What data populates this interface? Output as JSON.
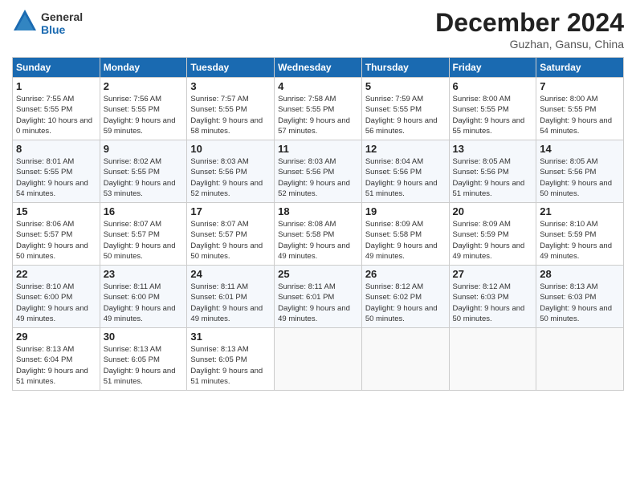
{
  "header": {
    "logo_line1": "General",
    "logo_line2": "Blue",
    "month": "December 2024",
    "location": "Guzhan, Gansu, China"
  },
  "days_of_week": [
    "Sunday",
    "Monday",
    "Tuesday",
    "Wednesday",
    "Thursday",
    "Friday",
    "Saturday"
  ],
  "weeks": [
    [
      {
        "day": 1,
        "sunrise": "7:55 AM",
        "sunset": "5:55 PM",
        "daylight": "10 hours and 0 minutes."
      },
      {
        "day": 2,
        "sunrise": "7:56 AM",
        "sunset": "5:55 PM",
        "daylight": "9 hours and 59 minutes."
      },
      {
        "day": 3,
        "sunrise": "7:57 AM",
        "sunset": "5:55 PM",
        "daylight": "9 hours and 58 minutes."
      },
      {
        "day": 4,
        "sunrise": "7:58 AM",
        "sunset": "5:55 PM",
        "daylight": "9 hours and 57 minutes."
      },
      {
        "day": 5,
        "sunrise": "7:59 AM",
        "sunset": "5:55 PM",
        "daylight": "9 hours and 56 minutes."
      },
      {
        "day": 6,
        "sunrise": "8:00 AM",
        "sunset": "5:55 PM",
        "daylight": "9 hours and 55 minutes."
      },
      {
        "day": 7,
        "sunrise": "8:00 AM",
        "sunset": "5:55 PM",
        "daylight": "9 hours and 54 minutes."
      }
    ],
    [
      {
        "day": 8,
        "sunrise": "8:01 AM",
        "sunset": "5:55 PM",
        "daylight": "9 hours and 54 minutes."
      },
      {
        "day": 9,
        "sunrise": "8:02 AM",
        "sunset": "5:55 PM",
        "daylight": "9 hours and 53 minutes."
      },
      {
        "day": 10,
        "sunrise": "8:03 AM",
        "sunset": "5:56 PM",
        "daylight": "9 hours and 52 minutes."
      },
      {
        "day": 11,
        "sunrise": "8:03 AM",
        "sunset": "5:56 PM",
        "daylight": "9 hours and 52 minutes."
      },
      {
        "day": 12,
        "sunrise": "8:04 AM",
        "sunset": "5:56 PM",
        "daylight": "9 hours and 51 minutes."
      },
      {
        "day": 13,
        "sunrise": "8:05 AM",
        "sunset": "5:56 PM",
        "daylight": "9 hours and 51 minutes."
      },
      {
        "day": 14,
        "sunrise": "8:05 AM",
        "sunset": "5:56 PM",
        "daylight": "9 hours and 50 minutes."
      }
    ],
    [
      {
        "day": 15,
        "sunrise": "8:06 AM",
        "sunset": "5:57 PM",
        "daylight": "9 hours and 50 minutes."
      },
      {
        "day": 16,
        "sunrise": "8:07 AM",
        "sunset": "5:57 PM",
        "daylight": "9 hours and 50 minutes."
      },
      {
        "day": 17,
        "sunrise": "8:07 AM",
        "sunset": "5:57 PM",
        "daylight": "9 hours and 50 minutes."
      },
      {
        "day": 18,
        "sunrise": "8:08 AM",
        "sunset": "5:58 PM",
        "daylight": "9 hours and 49 minutes."
      },
      {
        "day": 19,
        "sunrise": "8:09 AM",
        "sunset": "5:58 PM",
        "daylight": "9 hours and 49 minutes."
      },
      {
        "day": 20,
        "sunrise": "8:09 AM",
        "sunset": "5:59 PM",
        "daylight": "9 hours and 49 minutes."
      },
      {
        "day": 21,
        "sunrise": "8:10 AM",
        "sunset": "5:59 PM",
        "daylight": "9 hours and 49 minutes."
      }
    ],
    [
      {
        "day": 22,
        "sunrise": "8:10 AM",
        "sunset": "6:00 PM",
        "daylight": "9 hours and 49 minutes."
      },
      {
        "day": 23,
        "sunrise": "8:11 AM",
        "sunset": "6:00 PM",
        "daylight": "9 hours and 49 minutes."
      },
      {
        "day": 24,
        "sunrise": "8:11 AM",
        "sunset": "6:01 PM",
        "daylight": "9 hours and 49 minutes."
      },
      {
        "day": 25,
        "sunrise": "8:11 AM",
        "sunset": "6:01 PM",
        "daylight": "9 hours and 49 minutes."
      },
      {
        "day": 26,
        "sunrise": "8:12 AM",
        "sunset": "6:02 PM",
        "daylight": "9 hours and 50 minutes."
      },
      {
        "day": 27,
        "sunrise": "8:12 AM",
        "sunset": "6:03 PM",
        "daylight": "9 hours and 50 minutes."
      },
      {
        "day": 28,
        "sunrise": "8:13 AM",
        "sunset": "6:03 PM",
        "daylight": "9 hours and 50 minutes."
      }
    ],
    [
      {
        "day": 29,
        "sunrise": "8:13 AM",
        "sunset": "6:04 PM",
        "daylight": "9 hours and 51 minutes."
      },
      {
        "day": 30,
        "sunrise": "8:13 AM",
        "sunset": "6:05 PM",
        "daylight": "9 hours and 51 minutes."
      },
      {
        "day": 31,
        "sunrise": "8:13 AM",
        "sunset": "6:05 PM",
        "daylight": "9 hours and 51 minutes."
      },
      null,
      null,
      null,
      null
    ]
  ]
}
